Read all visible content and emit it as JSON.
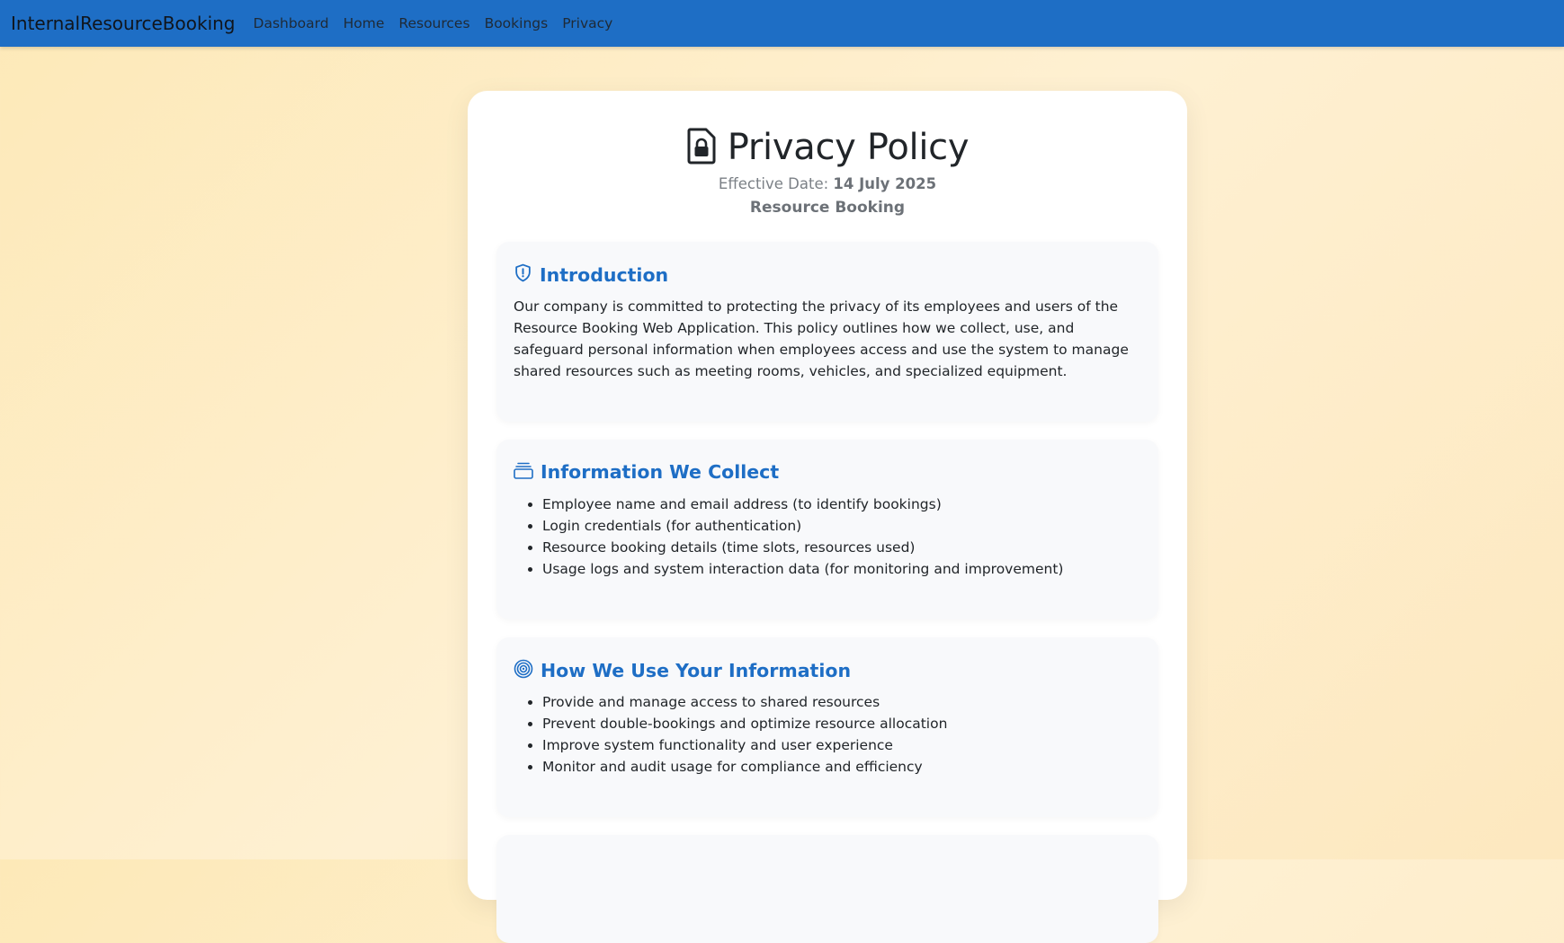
{
  "nav": {
    "brand": "InternalResourceBooking",
    "links": [
      "Dashboard",
      "Home",
      "Resources",
      "Bookings",
      "Privacy"
    ]
  },
  "header": {
    "title": "Privacy Policy",
    "effective_label": "Effective Date:",
    "effective_date": "14 July 2025",
    "subtitle": "Resource Booking",
    "icon": "file-lock-icon"
  },
  "sections": [
    {
      "title": "Introduction",
      "icon": "shield-exclamation-icon",
      "body": "Our company is committed to protecting the privacy of its employees and users of the Resource Booking Web Application. This policy outlines how we collect, use, and safeguard personal information when employees access and use the system to manage shared resources such as meeting rooms, vehicles, and specialized equipment."
    },
    {
      "title": "Information We Collect",
      "icon": "collection-icon",
      "items": [
        "Employee name and email address (to identify bookings)",
        "Login credentials (for authentication)",
        "Resource booking details (time slots, resources used)",
        "Usage logs and system interaction data (for monitoring and improvement)"
      ]
    },
    {
      "title": "How We Use Your Information",
      "icon": "target-icon",
      "items": [
        "Provide and manage access to shared resources",
        "Prevent double-bookings and optimize resource allocation",
        "Improve system functionality and user experience",
        "Monitor and audit usage for compliance and efficiency"
      ]
    }
  ],
  "colors": {
    "navbar": "#1e6ec5",
    "accent": "#1e6ec5",
    "section_bg": "#f8f9fb"
  }
}
